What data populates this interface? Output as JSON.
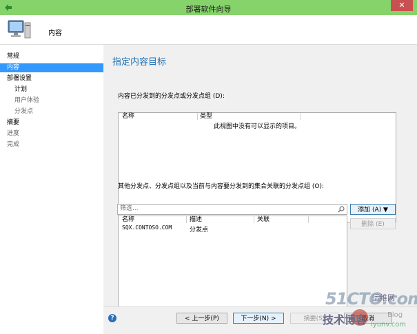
{
  "window": {
    "title": "部署软件向导",
    "close_glyph": "✕"
  },
  "header": {
    "title": "内容"
  },
  "nav": {
    "items": [
      {
        "label": "常规",
        "state": "normal"
      },
      {
        "label": "内容",
        "state": "selected"
      },
      {
        "label": "部署设置",
        "state": "normal"
      },
      {
        "label": "计划",
        "state": "sub"
      },
      {
        "label": "用户体验",
        "state": "sub-dim"
      },
      {
        "label": "分发点",
        "state": "sub-dim"
      },
      {
        "label": "摘要",
        "state": "normal"
      },
      {
        "label": "进度",
        "state": "dim"
      },
      {
        "label": "完成",
        "state": "dim"
      }
    ]
  },
  "main": {
    "title": "指定内容目标",
    "distributed_label": "内容已分发到的分发点或分发点组 (D):",
    "distributed_list": {
      "columns": [
        "名称",
        "类型"
      ],
      "empty_message": "此视图中没有可以显示的项目。"
    },
    "other_label": "其他分发点、分发点组以及当前与内容要分发到的集合关联的分发点组 (O):",
    "filter": {
      "placeholder": "筛选..."
    },
    "add_button": "添加 (A)",
    "remove_button": "删除 (E)",
    "other_list": {
      "columns": [
        "名称",
        "描述",
        "关联"
      ],
      "rows": [
        {
          "name": "SQX.CONTOSO.COM",
          "description": "分发点",
          "association": ""
        }
      ]
    }
  },
  "footer": {
    "prev_button": "< 上一步(P)",
    "next_button": "下一步(N) >",
    "summary_button": "摘要(S)",
    "cancel_button": "取消"
  },
  "watermark": {
    "line1": "51CTO.com",
    "line2": "技术博客",
    "line3": "运维网",
    "line4": "iyunv.com",
    "line5": "Blog"
  },
  "colors": {
    "titlebar": "#86d36b",
    "selection": "#3399ff",
    "heading": "#1a6fb5"
  }
}
